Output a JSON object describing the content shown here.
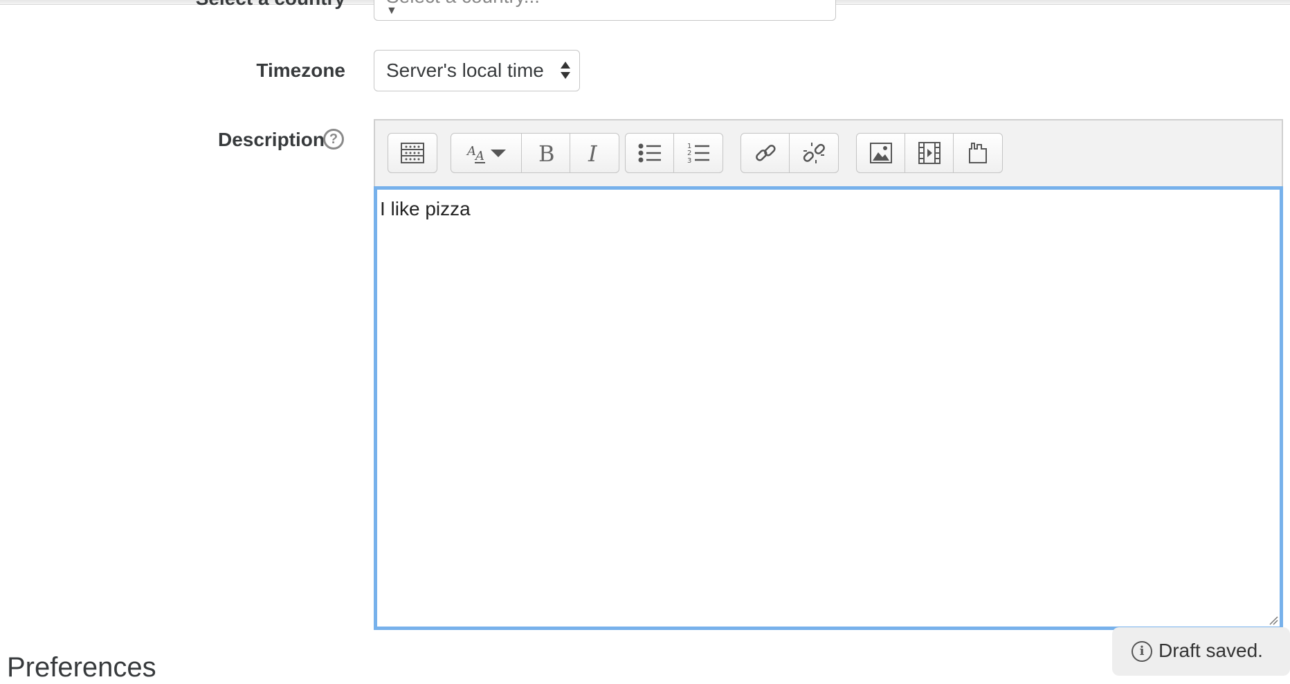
{
  "country": {
    "label": "Select a country",
    "placeholder": "Select a country..."
  },
  "timezone": {
    "label": "Timezone",
    "value": "Server's local time"
  },
  "description": {
    "label": "Description",
    "help": "?",
    "content": "I like pizza",
    "toolbar": {
      "groups": [
        [
          "toolbar-toggle-icon"
        ],
        [
          "font-style-icon",
          "bold-icon",
          "italic-icon"
        ],
        [
          "bullet-list-icon",
          "numbered-list-icon"
        ],
        [
          "link-icon",
          "unlink-icon"
        ],
        [
          "image-icon",
          "media-icon",
          "manage-files-icon"
        ]
      ]
    }
  },
  "status": {
    "message": "Draft saved.",
    "icon": "info-icon"
  },
  "section": {
    "heading": "Preferences"
  },
  "colors": {
    "focus_border": "#77b1eb",
    "toolbar_bg": "#f2f2f2"
  }
}
